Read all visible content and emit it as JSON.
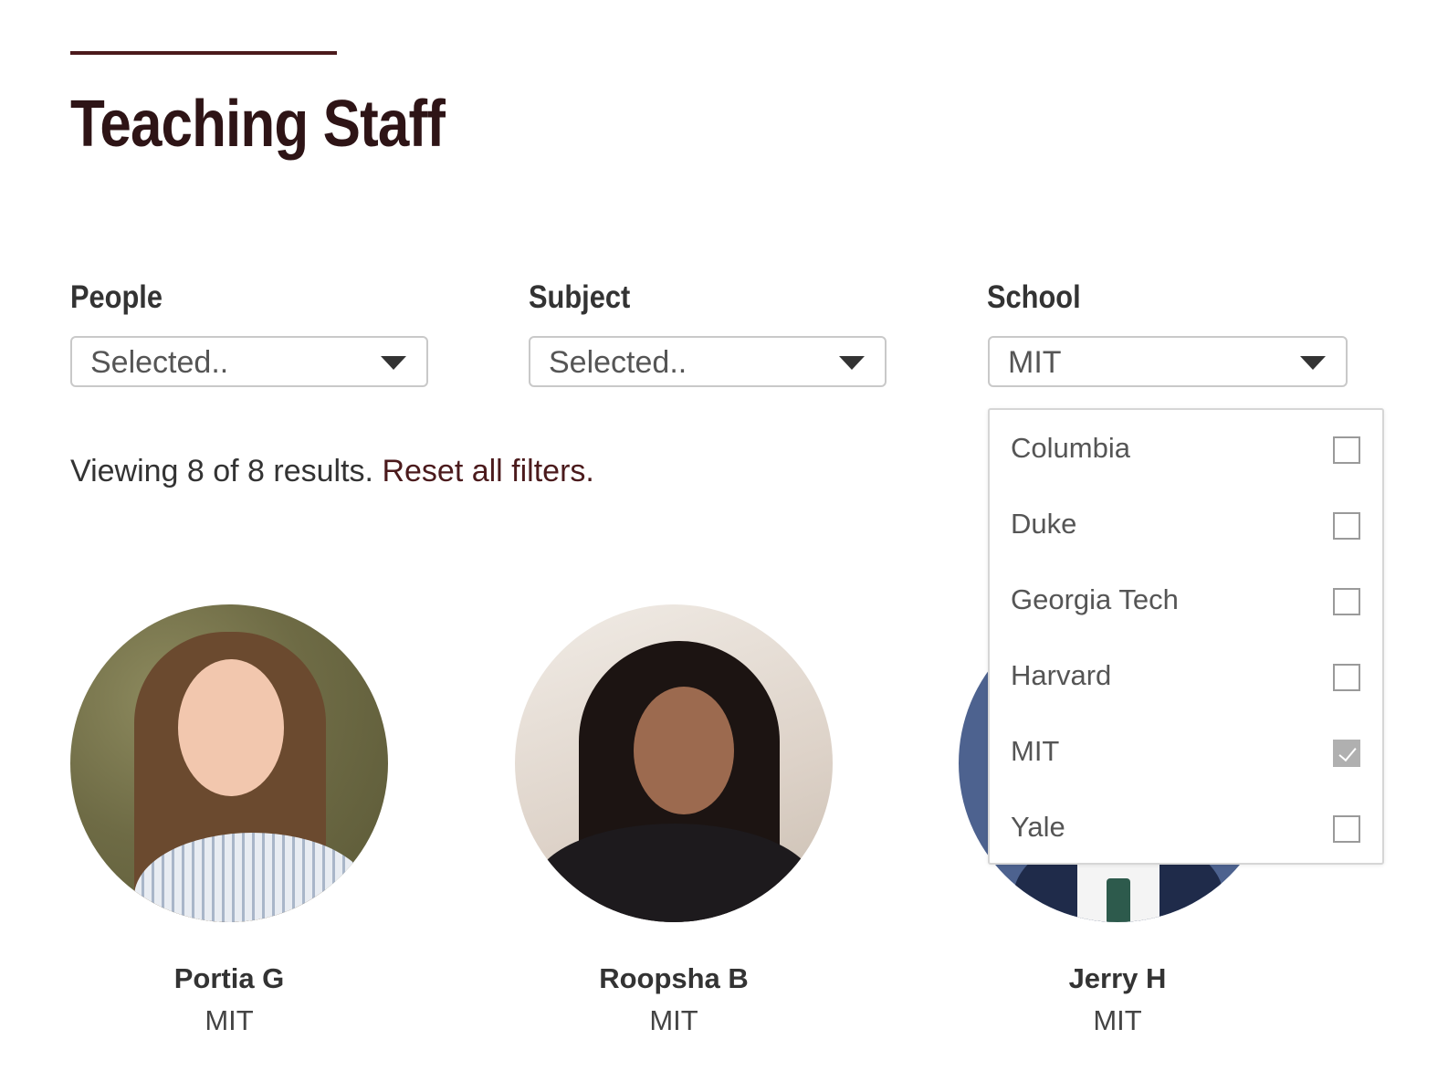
{
  "header": {
    "title": "Teaching Staff"
  },
  "filters": {
    "people": {
      "label": "People",
      "value": "Selected.."
    },
    "subject": {
      "label": "Subject",
      "value": "Selected.."
    },
    "school": {
      "label": "School",
      "value": "MIT"
    }
  },
  "results": {
    "summary": "Viewing 8 of 8 results.",
    "reset_label": "Reset all filters."
  },
  "school_dropdown": {
    "options": [
      {
        "label": "Columbia",
        "checked": false
      },
      {
        "label": "Duke",
        "checked": false
      },
      {
        "label": "Georgia Tech",
        "checked": false
      },
      {
        "label": "Harvard",
        "checked": false
      },
      {
        "label": "MIT",
        "checked": true
      },
      {
        "label": "Yale",
        "checked": false
      }
    ]
  },
  "staff": [
    {
      "name": "Portia G",
      "school": "MIT"
    },
    {
      "name": "Roopsha B",
      "school": "MIT"
    },
    {
      "name": "Jerry H",
      "school": "MIT"
    }
  ],
  "colors": {
    "accent": "#4b1a1c",
    "title": "#2e1416"
  }
}
